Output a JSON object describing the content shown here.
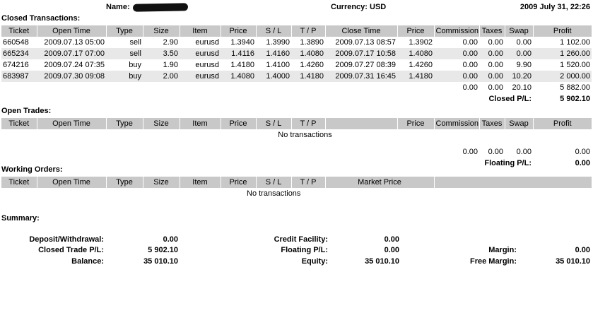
{
  "header": {
    "name_label": "Name:",
    "currency": "Currency: USD",
    "datetime": "2009 July 31, 22:26"
  },
  "closed": {
    "title": "Closed Transactions:",
    "columns": [
      "Ticket",
      "Open Time",
      "Type",
      "Size",
      "Item",
      "Price",
      "S / L",
      "T / P",
      "Close Time",
      "Price",
      "Commission",
      "Taxes",
      "Swap",
      "Profit"
    ],
    "rows": [
      [
        "660548",
        "2009.07.13 05:00",
        "sell",
        "2.90",
        "eurusd",
        "1.3940",
        "1.3990",
        "1.3890",
        "2009.07.13 08:57",
        "1.3902",
        "0.00",
        "0.00",
        "0.00",
        "1 102.00"
      ],
      [
        "665234",
        "2009.07.17 07:00",
        "sell",
        "3.50",
        "eurusd",
        "1.4116",
        "1.4160",
        "1.4080",
        "2009.07.17 10:58",
        "1.4080",
        "0.00",
        "0.00",
        "0.00",
        "1 260.00"
      ],
      [
        "674216",
        "2009.07.24 07:35",
        "buy",
        "1.90",
        "eurusd",
        "1.4180",
        "1.4100",
        "1.4260",
        "2009.07.27 08:39",
        "1.4260",
        "0.00",
        "0.00",
        "9.90",
        "1 520.00"
      ],
      [
        "683987",
        "2009.07.30 09:08",
        "buy",
        "2.00",
        "eurusd",
        "1.4080",
        "1.4000",
        "1.4180",
        "2009.07.31 16:45",
        "1.4180",
        "0.00",
        "0.00",
        "10.20",
        "2 000.00"
      ]
    ],
    "totals": {
      "commission": "0.00",
      "taxes": "0.00",
      "swap": "20.10",
      "profit": "5 882.00"
    },
    "pl_label": "Closed P/L:",
    "pl_value": "5 902.10"
  },
  "open": {
    "title": "Open Trades:",
    "columns": [
      "Ticket",
      "Open Time",
      "Type",
      "Size",
      "Item",
      "Price",
      "S / L",
      "T / P",
      "",
      "Price",
      "Commission",
      "Taxes",
      "Swap",
      "Profit"
    ],
    "empty": "No transactions",
    "totals": {
      "commission": "0.00",
      "taxes": "0.00",
      "swap": "0.00",
      "profit": "0.00"
    },
    "pl_label": "Floating P/L:",
    "pl_value": "0.00"
  },
  "orders": {
    "title": "Working Orders:",
    "columns": [
      "Ticket",
      "Open Time",
      "Type",
      "Size",
      "Item",
      "Price",
      "S / L",
      "T / P",
      "Market Price",
      ""
    ],
    "empty": "No transactions"
  },
  "summary": {
    "title": "Summary:",
    "deposit_label": "Deposit/Withdrawal:",
    "deposit_value": "0.00",
    "closed_pl_label": "Closed Trade P/L:",
    "closed_pl_value": "5 902.10",
    "balance_label": "Balance:",
    "balance_value": "35 010.10",
    "credit_label": "Credit Facility:",
    "credit_value": "0.00",
    "floating_label": "Floating P/L:",
    "floating_value": "0.00",
    "equity_label": "Equity:",
    "equity_value": "35 010.10",
    "margin_label": "Margin:",
    "margin_value": "0.00",
    "free_margin_label": "Free Margin:",
    "free_margin_value": "35 010.10"
  }
}
